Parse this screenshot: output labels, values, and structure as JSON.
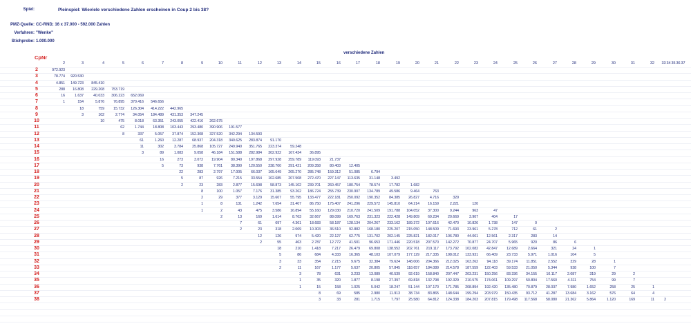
{
  "meta": {
    "spiel_label": "Spiel:",
    "spiel_value": "Pleinspiel: Wieviele verschiedene Zahlen erscheinen in Coup 2 bis 38?",
    "quelle_label": "PMZ-Quelle:",
    "quelle_value": "CC-RND; 16 x 37.000 - 592.000 Zahlen",
    "verfahren_label": "Verfahren:",
    "verfahren_value": "\"Wenke\"",
    "stichprobe_label": "Stichprobe:",
    "stichprobe_value": "1.000.000"
  },
  "table": {
    "section_title": "verschiedene Zahlen",
    "corner_label": "CpNr",
    "columns": [
      "2",
      "3",
      "4",
      "5",
      "6",
      "7",
      "8",
      "9",
      "10",
      "11",
      "12",
      "13",
      "14",
      "15",
      "16",
      "17",
      "18",
      "19",
      "20",
      "21",
      "22",
      "23",
      "24",
      "25",
      "26",
      "27",
      "28",
      "29",
      "30",
      "31",
      "32",
      "33",
      "34",
      "35",
      "36",
      "37"
    ],
    "rows": [
      {
        "cp": "2",
        "start": 0,
        "cells": [
          "972.923"
        ]
      },
      {
        "cp": "3",
        "start": 0,
        "cells": [
          "78.774",
          "920.530"
        ]
      },
      {
        "cp": "4",
        "start": 0,
        "cells": [
          "4.851",
          "149.723",
          "845.410"
        ]
      },
      {
        "cp": "5",
        "start": 0,
        "cells": [
          "288",
          "16.808",
          "229.208",
          "753.719"
        ]
      },
      {
        "cp": "6",
        "start": 0,
        "cells": [
          "16",
          "1.637",
          "40.033",
          "306.223",
          "652.069"
        ]
      },
      {
        "cp": "7",
        "start": 0,
        "cells": [
          "1",
          "154",
          "5.876",
          "76.895",
          "370.416",
          "546.656"
        ]
      },
      {
        "cp": "8",
        "start": 1,
        "cells": [
          "18",
          "759",
          "15.732",
          "126.304",
          "414.222",
          "442.965"
        ]
      },
      {
        "cp": "9",
        "start": 1,
        "cells": [
          "3",
          "102",
          "2.774",
          "34.054",
          "184.489",
          "431.353",
          "347.245"
        ]
      },
      {
        "cp": "10",
        "start": 2,
        "cells": [
          "10",
          "475",
          "8.018",
          "63.351",
          "243.055",
          "422.416",
          "262.675"
        ]
      },
      {
        "cp": "11",
        "start": 3,
        "cells": [
          "62",
          "1.744",
          "18.808",
          "103.443",
          "293.480",
          "390.906",
          "191.577"
        ]
      },
      {
        "cp": "12",
        "start": 3,
        "cells": [
          "8",
          "337",
          "5.057",
          "37.874",
          "152.308",
          "327.520",
          "342.294",
          "134.593"
        ]
      },
      {
        "cp": "13",
        "start": 4,
        "cells": [
          "61",
          "1.260",
          "12.287",
          "68.937",
          "204.318",
          "340.625",
          "283.874",
          "91.170"
        ]
      },
      {
        "cp": "14",
        "start": 4,
        "cells": [
          "11",
          "302",
          "3.784",
          "25.868",
          "105.727",
          "249.940",
          "351.765",
          "223.374",
          "59.248"
        ]
      },
      {
        "cp": "15",
        "start": 4,
        "cells": [
          "3",
          "89",
          "1.083",
          "9.058",
          "46.184",
          "151.588",
          "282.984",
          "302.922",
          "167.434",
          "36.895"
        ]
      },
      {
        "cp": "16",
        "start": 5,
        "cells": [
          "16",
          "273",
          "3.072",
          "19.904",
          "80.340",
          "197.868",
          "297.928",
          "259.789",
          "119.093",
          "21.737"
        ]
      },
      {
        "cp": "17",
        "start": 5,
        "cells": [
          "5",
          "73",
          "938",
          "7.761",
          "38.390",
          "120.550",
          "238.700",
          "291.421",
          "209.358",
          "80.403",
          "12.405"
        ]
      },
      {
        "cp": "18",
        "start": 6,
        "cells": [
          "22",
          "283",
          "2.797",
          "17.005",
          "66.037",
          "165.649",
          "265.270",
          "285.748",
          "159.312",
          "51.085",
          "6.794"
        ]
      },
      {
        "cp": "19",
        "start": 6,
        "cells": [
          "5",
          "87",
          "926",
          "7.215",
          "33.554",
          "102.685",
          "207.508",
          "272.470",
          "227.147",
          "113.635",
          "31.148",
          "3.492"
        ]
      },
      {
        "cp": "20",
        "start": 6,
        "cells": [
          "2",
          "23",
          "283",
          "2.877",
          "15.698",
          "58.873",
          "145.102",
          "239.701",
          "260.457",
          "180.754",
          "78.574",
          "17.782",
          "1.682"
        ]
      },
      {
        "cp": "21",
        "start": 7,
        "cells": [
          "8",
          "100",
          "1.057",
          "7.176",
          "31.385",
          "93.262",
          "186.724",
          "255.739",
          "230.907",
          "134.789",
          "49.586",
          "9.464",
          "763"
        ]
      },
      {
        "cp": "22",
        "start": 7,
        "cells": [
          "2",
          "29",
          "377",
          "3.129",
          "15.607",
          "55.795",
          "133.477",
          "222.181",
          "250.092",
          "190.352",
          "84.385",
          "26.827",
          "4.716",
          "329"
        ]
      },
      {
        "cp": "23",
        "start": 7,
        "cells": [
          "1",
          "8",
          "131",
          "1.242",
          "7.654",
          "31.407",
          "86.750",
          "175.407",
          "241.296",
          "229.572",
          "145.810",
          "64.214",
          "16.159",
          "2.221",
          "120"
        ]
      },
      {
        "cp": "24",
        "start": 7,
        "cells": [
          "1",
          "2",
          "43",
          "475",
          "3.586",
          "16.894",
          "55.160",
          "129.030",
          "210.720",
          "241.509",
          "191.788",
          "104.052",
          "37.300",
          "9.244",
          "963",
          "47"
        ]
      },
      {
        "cp": "25",
        "start": 8,
        "cells": [
          "2",
          "13",
          "169",
          "1.614",
          "8.763",
          "32.667",
          "88.099",
          "169.763",
          "231.323",
          "222.428",
          "149.809",
          "69.234",
          "20.669",
          "3.907",
          "404",
          "17"
        ]
      },
      {
        "cp": "26",
        "start": 9,
        "cells": [
          "7",
          "61",
          "697",
          "4.361",
          "18.683",
          "58.187",
          "128.134",
          "204.267",
          "233.162",
          "189.372",
          "107.616",
          "42.470",
          "10.826",
          "1.738",
          "147",
          "0"
        ]
      },
      {
        "cp": "27",
        "start": 9,
        "cells": [
          "2",
          "23",
          "318",
          "2.069",
          "10.303",
          "36.510",
          "92.882",
          "168.180",
          "225.207",
          "215.050",
          "148.509",
          "71.693",
          "23.961",
          "5.278",
          "712",
          "61",
          "2"
        ]
      },
      {
        "cp": "28",
        "start": 10,
        "cells": [
          "12",
          "126",
          "974",
          "5.420",
          "22.127",
          "62.775",
          "131.702",
          "202.145",
          "225.821",
          "182.017",
          "106.780",
          "44.061",
          "12.561",
          "2.317",
          "283",
          "14"
        ]
      },
      {
        "cp": "29",
        "start": 10,
        "cells": [
          "2",
          "55",
          "463",
          "2.787",
          "12.772",
          "41.501",
          "96.653",
          "171.446",
          "220.518",
          "207.570",
          "142.272",
          "70.877",
          "24.707",
          "5.965",
          "920",
          "86",
          "6"
        ]
      },
      {
        "cp": "30",
        "start": 11,
        "cells": [
          "18",
          "210",
          "1.418",
          "7.217",
          "26.479",
          "69.808",
          "138.552",
          "202.761",
          "219.117",
          "173.792",
          "102.082",
          "42.847",
          "12.689",
          "2.664",
          "321",
          "24",
          "1"
        ]
      },
      {
        "cp": "31",
        "start": 11,
        "cells": [
          "5",
          "86",
          "684",
          "4.333",
          "16.365",
          "48.103",
          "107.079",
          "177.129",
          "217.335",
          "198.012",
          "133.931",
          "66.409",
          "23.733",
          "5.971",
          "1.016",
          "104",
          "5"
        ]
      },
      {
        "cp": "32",
        "start": 11,
        "cells": [
          "3",
          "33",
          "354",
          "2.215",
          "9.675",
          "32.384",
          "79.624",
          "148.006",
          "204.366",
          "212.025",
          "163.262",
          "94.118",
          "39.174",
          "11.851",
          "2.552",
          "329",
          "28",
          "1"
        ]
      },
      {
        "cp": "33",
        "start": 11,
        "cells": [
          "2",
          "11",
          "167",
          "1.177",
          "5.637",
          "20.805",
          "57.845",
          "118.657",
          "184.089",
          "214.578",
          "187.559",
          "122.403",
          "59.533",
          "21.050",
          "5.344",
          "938",
          "100",
          "7"
        ]
      },
      {
        "cp": "34",
        "start": 12,
        "cells": [
          "3",
          "78",
          "631",
          "3.233",
          "13.089",
          "40.539",
          "92.619",
          "158.840",
          "207.447",
          "203.231",
          "150.256",
          "83.336",
          "34.155",
          "10.117",
          "2.087",
          "319",
          "29",
          "2"
        ]
      },
      {
        "cp": "35",
        "start": 12,
        "cells": [
          "1",
          "35",
          "320",
          "1.877",
          "8.198",
          "27.397",
          "69.818",
          "132.798",
          "192.329",
          "210.575",
          "174.061",
          "109.297",
          "50.804",
          "17.560",
          "4.311",
          "754",
          "99",
          "7"
        ]
      },
      {
        "cp": "36",
        "start": 12,
        "cells": [
          "1",
          "15",
          "158",
          "1.025",
          "5.042",
          "18.247",
          "51.144",
          "107.170",
          "171.785",
          "208.894",
          "192.420",
          "135.480",
          "70.879",
          "28.037",
          "7.980",
          "1.652",
          "258",
          "25",
          "1"
        ]
      },
      {
        "cp": "37",
        "start": 13,
        "cells": [
          "8",
          "69",
          "585",
          "2.980",
          "11.913",
          "38.734",
          "83.865",
          "148.644",
          "199.294",
          "203.979",
          "150.435",
          "93.712",
          "41.287",
          "13.684",
          "3.162",
          "576",
          "64",
          "4"
        ]
      },
      {
        "cp": "38",
        "start": 13,
        "cells": [
          "3",
          "33",
          "281",
          "1.715",
          "7.797",
          "25.580",
          "64.812",
          "124.338",
          "184.203",
          "207.815",
          "179.498",
          "117.568",
          "58.080",
          "21.362",
          "5.864",
          "1.120",
          "169",
          "11",
          "2"
        ]
      }
    ]
  }
}
